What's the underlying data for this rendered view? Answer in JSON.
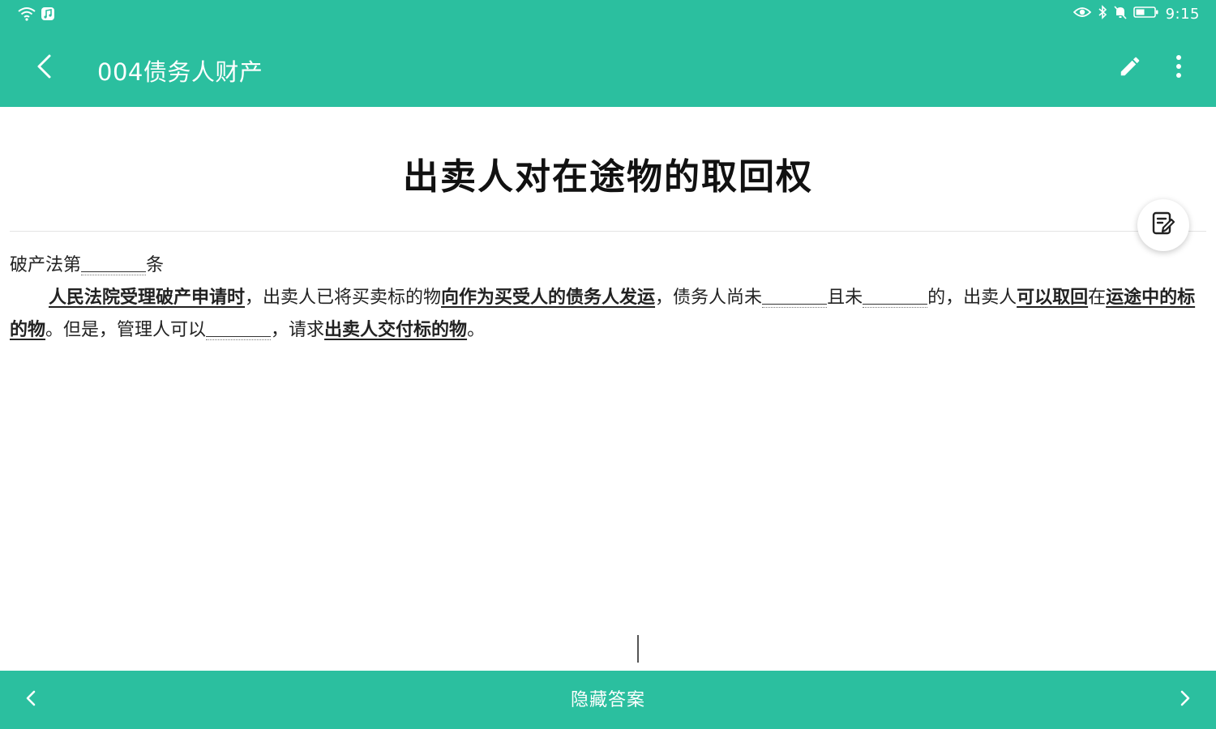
{
  "status_bar": {
    "time": "9:15",
    "icons": [
      "wifi-icon",
      "music-app-icon",
      "eye-icon",
      "bluetooth-icon",
      "mute-bell-icon",
      "battery-icon"
    ]
  },
  "app_bar": {
    "title": "004债务人财产",
    "icons": [
      "back-arrow-icon",
      "pencil-icon",
      "more-vert-icon"
    ]
  },
  "document": {
    "title": "出卖人对在途物的取回权",
    "line1": {
      "before": "破产法第",
      "after": "条"
    },
    "para": {
      "kw1": "人民法院受理破产申请时",
      "t1": "，出卖人已将买卖标的物",
      "kw2": "向作为买受人的债务人发运",
      "t2": "，债务人尚未",
      "t3": "且未",
      "t4": "的，出卖人",
      "kw3": "可以取回",
      "t5": "在",
      "kw4": "运途中的标的物",
      "t6": "。但是，管理人可以",
      "t7": "，请求",
      "kw5": "出卖人交付标的物",
      "t8": "。"
    }
  },
  "floating_button": {
    "icon": "edit-note-icon"
  },
  "bottom_bar": {
    "center_label": "隐藏答案",
    "icons": [
      "chevron-left-icon",
      "chevron-right-icon"
    ]
  },
  "colors": {
    "primary": "#2bbf9f",
    "text": "#222222"
  }
}
